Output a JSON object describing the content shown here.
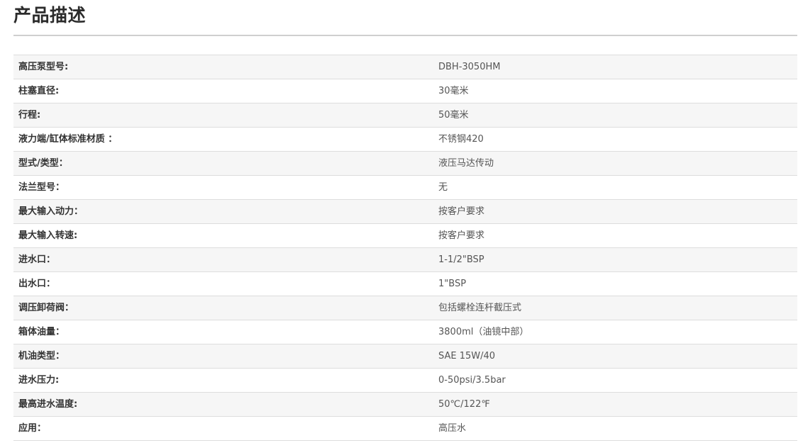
{
  "section": {
    "title": "产品描述"
  },
  "specs": [
    {
      "label": "高压泵型号:",
      "value": "DBH-3050HM"
    },
    {
      "label": "柱塞直径:",
      "value": "30毫米"
    },
    {
      "label": "行程:",
      "value": "50毫米"
    },
    {
      "label": "液力端/缸体标准材质 ：",
      "value": "不锈钢420"
    },
    {
      "label": "型式/类型：",
      "value": "液压马达传动"
    },
    {
      "label": "法兰型号：",
      "value": "无"
    },
    {
      "label": "最大输入动力：",
      "value": "按客户要求"
    },
    {
      "label": "最大输入转速:",
      "value": "按客户要求"
    },
    {
      "label": "进水口：",
      "value": "1-1/2\"BSP"
    },
    {
      "label": "出水口：",
      "value": "1\"BSP"
    },
    {
      "label": "调压卸荷阀：",
      "value": "包括螺栓连杆截压式"
    },
    {
      "label": "箱体油量：",
      "value": "3800ml（油镜中部）"
    },
    {
      "label": "机油类型：",
      "value": "SAE 15W/40"
    },
    {
      "label": "进水压力:",
      "value": "0-50psi/3.5bar"
    },
    {
      "label": "最高进水温度:",
      "value": "50℃/122℉"
    },
    {
      "label": "应用：",
      "value": "高压水"
    }
  ]
}
